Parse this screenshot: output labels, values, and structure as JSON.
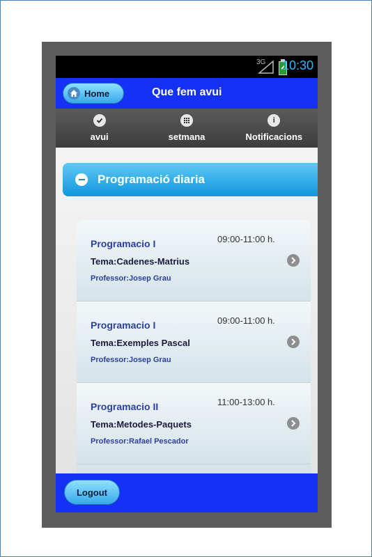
{
  "status_bar": {
    "network": "3G",
    "time": "10:30"
  },
  "header": {
    "home_label": "Home",
    "title": "Que fem avui"
  },
  "tabs": [
    {
      "label": "avui",
      "icon": "check-icon"
    },
    {
      "label": "setmana",
      "icon": "grid-icon"
    },
    {
      "label": "Notificacions",
      "icon": "info-icon"
    }
  ],
  "section": {
    "title": "Programació diaria"
  },
  "sessions": [
    {
      "title": "Programacio I",
      "time": "09:00-11:00 h.",
      "topic": "Tema:Cadenes-Matrius",
      "professor": "Professor:Josep Grau"
    },
    {
      "title": "Programacio I",
      "time": "09:00-11:00 h.",
      "topic": "Tema:Exemples Pascal",
      "professor": "Professor:Josep Grau"
    },
    {
      "title": "Programacio II",
      "time": "11:00-13:00 h.",
      "topic": "Tema:Metodes-Paquets",
      "professor": "Professor:Rafael Pescador"
    }
  ],
  "footer": {
    "logout_label": "Logout"
  },
  "colors": {
    "header_blue": "#1531f5",
    "accent_cyan": "#1a9fe0",
    "clock_blue": "#2fb6ff"
  }
}
